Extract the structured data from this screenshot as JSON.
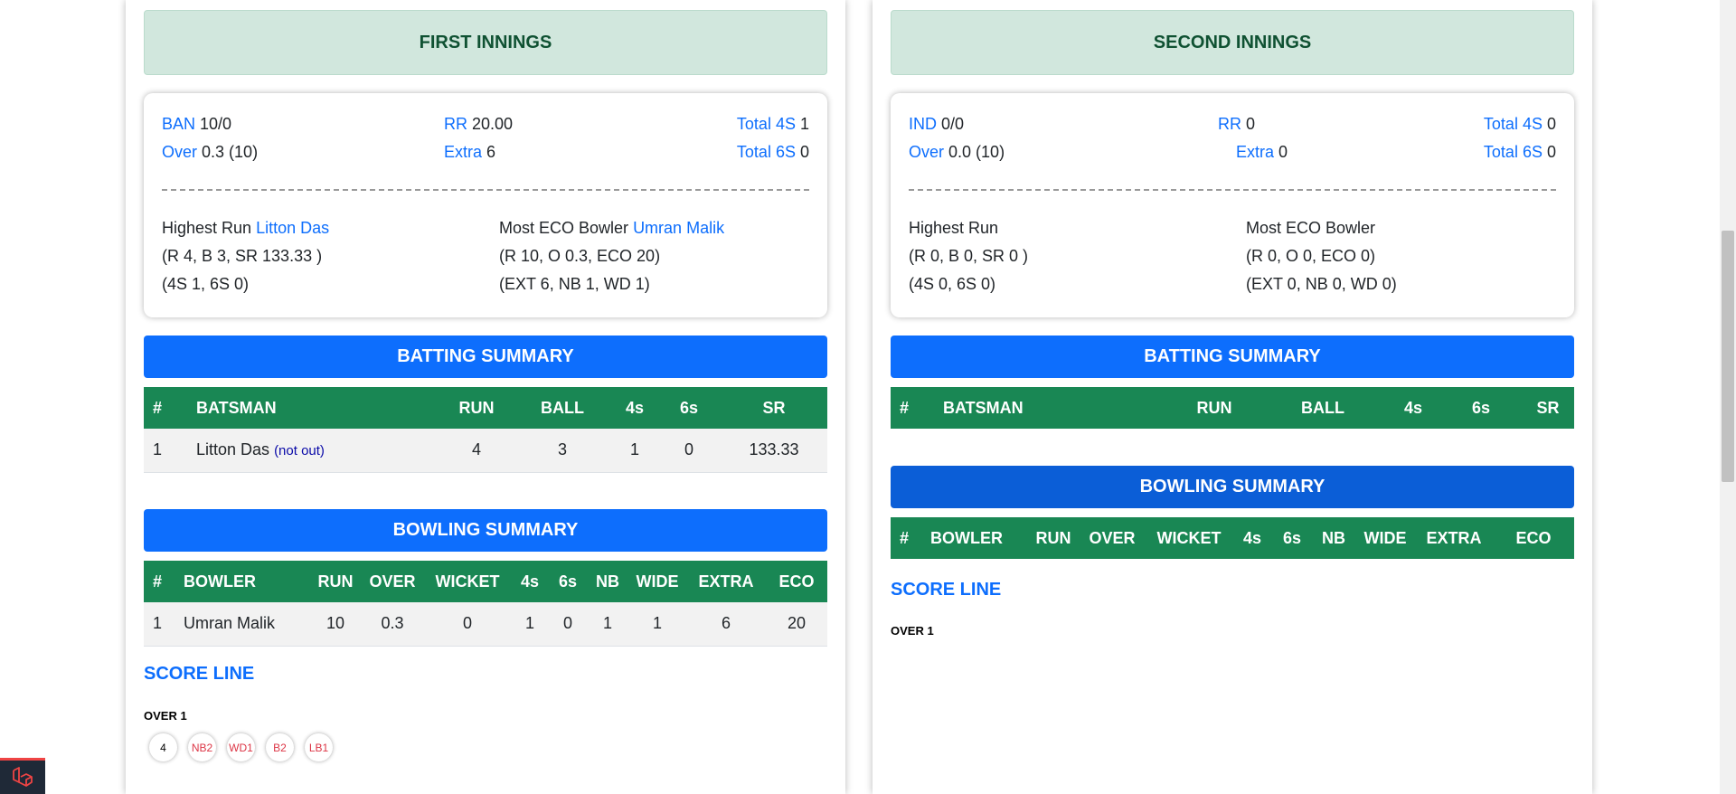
{
  "first": {
    "header": "FIRST INNINGS",
    "team": "BAN",
    "score": "10/0",
    "rr_label": "RR",
    "rr": "20.00",
    "t4_label": "Total 4S",
    "t4": "1",
    "over_label": "Over",
    "over": "0.3 (10)",
    "extra_label": "Extra",
    "extra": "6",
    "t6_label": "Total 6S",
    "t6": "0",
    "highest_label": "Highest Run",
    "highest_name": "Litton Das",
    "highest_l2": "(R 4, B 3, SR 133.33 )",
    "highest_l3": "(4S 1, 6S 0)",
    "eco_label": "Most ECO Bowler",
    "eco_name": "Umran Malik",
    "eco_l2": "(R 10, O 0.3, ECO 20)",
    "eco_l3": "(EXT 6, NB 1, WD 1)",
    "batting_title": "BATTING SUMMARY",
    "batting_headers": [
      "#",
      "BATSMAN",
      "RUN",
      "BALL",
      "4s",
      "6s",
      "SR"
    ],
    "batting_rows": [
      {
        "n": "1",
        "name": "Litton Das",
        "status": "(not out)",
        "run": "4",
        "ball": "3",
        "fours": "1",
        "sixes": "0",
        "sr": "133.33"
      }
    ],
    "bowling_title": "BOWLING SUMMARY",
    "bowling_headers": [
      "#",
      "BOWLER",
      "RUN",
      "OVER",
      "WICKET",
      "4s",
      "6s",
      "NB",
      "WIDE",
      "EXTRA",
      "ECO"
    ],
    "bowling_rows": [
      {
        "n": "1",
        "name": "Umran Malik",
        "run": "10",
        "over": "0.3",
        "wicket": "0",
        "fours": "1",
        "sixes": "0",
        "nb": "1",
        "wide": "1",
        "extra": "6",
        "eco": "20"
      }
    ],
    "scoreline_title": "SCORE LINE",
    "over_title": "OVER 1",
    "balls": [
      "4",
      "NB2",
      "WD1",
      "B2",
      "LB1"
    ]
  },
  "second": {
    "header": "SECOND INNINGS",
    "team": "IND",
    "score": "0/0",
    "rr_label": "RR",
    "rr": "0",
    "t4_label": "Total 4S",
    "t4": "0",
    "over_label": "Over",
    "over": "0.0 (10)",
    "extra_label": "Extra",
    "extra": "0",
    "t6_label": "Total 6S",
    "t6": "0",
    "highest_label": "Highest Run",
    "highest_l2": "(R 0, B 0, SR 0 )",
    "highest_l3": "(4S 0, 6S 0)",
    "eco_label": "Most ECO Bowler",
    "eco_l2": "(R 0, O 0, ECO 0)",
    "eco_l3": "(EXT 0, NB 0, WD 0)",
    "batting_title": "BATTING SUMMARY",
    "batting_headers": [
      "#",
      "BATSMAN",
      "RUN",
      "BALL",
      "4s",
      "6s",
      "SR"
    ],
    "bowling_title": "BOWLING SUMMARY",
    "bowling_headers": [
      "#",
      "BOWLER",
      "RUN",
      "OVER",
      "WICKET",
      "4s",
      "6s",
      "NB",
      "WIDE",
      "EXTRA",
      "ECO"
    ],
    "scoreline_title": "SCORE LINE",
    "over_title": "OVER 1"
  },
  "colors": {
    "innings_header_bg": "#d1e7dd",
    "innings_header_text": "#0f5132",
    "accent_blue": "#0d6efd",
    "table_header_green": "#198754",
    "extra_ball_red": "#dc3545"
  },
  "icons": {
    "corner_logo": "laravel-icon"
  }
}
